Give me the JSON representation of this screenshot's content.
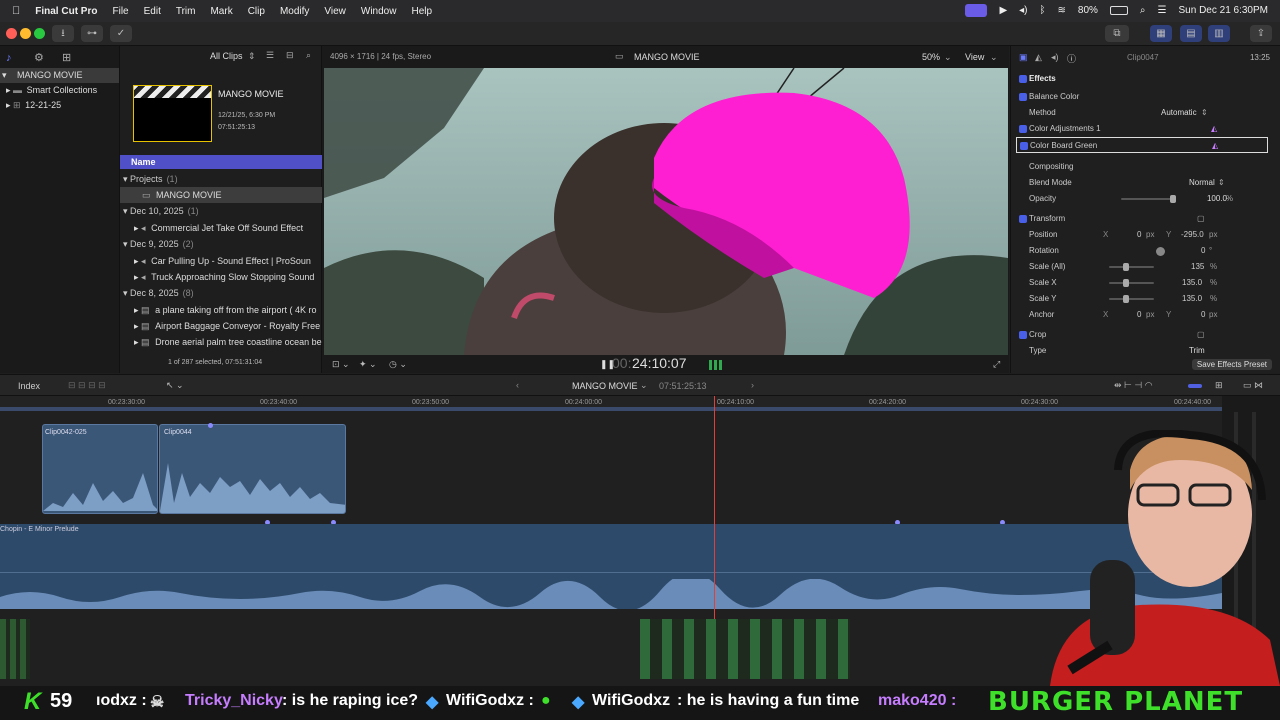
{
  "menubar": {
    "app": "Final Cut Pro",
    "items": [
      "File",
      "Edit",
      "Trim",
      "Mark",
      "Clip",
      "Modify",
      "View",
      "Window",
      "Help"
    ],
    "battery": "80%",
    "datetime": "Sun Dec 21  6:30PM"
  },
  "sidebar": {
    "library": "MANGO MOVIE",
    "items": [
      {
        "label": "Smart Collections"
      },
      {
        "label": "12-21-25"
      }
    ]
  },
  "browser": {
    "filter": "All Clips",
    "project": {
      "title": "MANGO MOVIE",
      "date": "12/21/25, 6:30 PM",
      "duration": "07:51:25:13"
    },
    "column_header": "Name",
    "groups": [
      {
        "label": "Projects",
        "count": "(1)",
        "items": [
          "MANGO MOVIE"
        ]
      },
      {
        "label": "Dec 10, 2025",
        "count": "(1)",
        "items": [
          "Commercial Jet Take Off Sound Effect"
        ]
      },
      {
        "label": "Dec 9, 2025",
        "count": "(2)",
        "items": [
          "Car Pulling Up - Sound Effect  |  ProSoun",
          "Truck Approaching Slow Stopping Sound"
        ]
      },
      {
        "label": "Dec 8, 2025",
        "count": "(8)",
        "items": [
          "a plane taking off from the airport ( 4K ro",
          "Airport Baggage Conveyor - Royalty Free",
          "Drone aerial palm tree coastline ocean be"
        ]
      }
    ],
    "status": "1 of 287 selected, 07:51:31:04"
  },
  "viewer": {
    "format": "4096 × 1716 | 24 fps, Stereo",
    "title": "MANGO MOVIE",
    "zoom": "50%",
    "view_label": "View",
    "timecode_dim": "00:",
    "timecode": "24:10:07"
  },
  "inspector": {
    "clip_name": "Clip0047",
    "duration": "13:25",
    "effects_label": "Effects",
    "balance_color": "Balance Color",
    "method_label": "Method",
    "method_value": "Automatic",
    "color_adjustments": "Color Adjustments 1",
    "color_board": "Color Board Green",
    "compositing": "Compositing",
    "blend_mode_label": "Blend Mode",
    "blend_mode_value": "Normal",
    "opacity_label": "Opacity",
    "opacity_value": "100.0",
    "opacity_unit": "%",
    "opacity_fraction": 1.0,
    "transform": "Transform",
    "position_label": "Position",
    "position_x": "0",
    "position_y": "-295.0",
    "rotation_label": "Rotation",
    "rotation_value": "0",
    "rotation_unit": "°",
    "scale_all_label": "Scale (All)",
    "scale_all_value": "135",
    "scale_x_label": "Scale X",
    "scale_x_value": "135.0",
    "scale_y_label": "Scale Y",
    "scale_y_value": "135.0",
    "anchor_label": "Anchor",
    "anchor_x": "0",
    "anchor_y": "0",
    "crop": "Crop",
    "type_label": "Type",
    "type_value": "Trim",
    "save_preset": "Save Effects Preset",
    "px": "px",
    "pct": "%",
    "x_label": "X",
    "y_label": "Y"
  },
  "timeline": {
    "index_label": "Index",
    "project": "MANGO MOVIE",
    "duration": "07:51:25:13",
    "ticks": [
      "00:23:30:00",
      "00:23:40:00",
      "00:23:50:00",
      "00:24:00:00",
      "00:24:10:00",
      "00:24:20:00",
      "00:24:30:00",
      "00:24:40:00"
    ],
    "clip1": "Clip0042-025",
    "clip2": "Clip0044",
    "music": "Chopin - E Minor Prelude"
  },
  "ticker": {
    "k_count": "59",
    "brand": "BURGER PLANET",
    "messages": [
      {
        "user": "ıodxz :",
        "text": "",
        "color": "#ffffff"
      },
      {
        "user": "Tricky_Nicky",
        "text": ": is he raping ice?",
        "color": "#c77dff"
      },
      {
        "user": "WifiGodxz :",
        "text": "",
        "color": "#ffffff"
      },
      {
        "user": "WifiGodxz",
        "text": ": he is having a fun time",
        "color": "#ffffff"
      },
      {
        "user": "mako420 :",
        "text": "",
        "color": "#c77dff"
      }
    ]
  },
  "colors": {
    "accent": "#4a5fe8",
    "selection": "#5050c8",
    "playhead": "#e0403a",
    "clip_blue": "#3b5778",
    "music_blue": "#2d4a6a",
    "brand_green": "#3ee02a"
  }
}
